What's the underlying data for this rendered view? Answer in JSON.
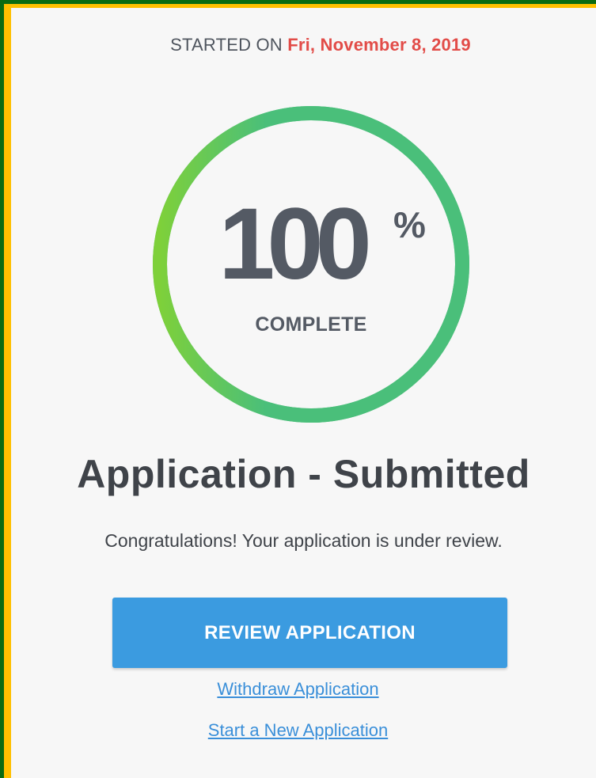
{
  "header": {
    "started_label": "STARTED ON",
    "started_date": "Fri, November 8, 2019"
  },
  "progress": {
    "value": 100,
    "number_text": "100",
    "percent_sign": "%",
    "label": "COMPLETE"
  },
  "status": {
    "title": "Application - Submitted",
    "message": "Congratulations! Your application is under review."
  },
  "actions": {
    "review_button": "REVIEW APPLICATION",
    "withdraw_link": "Withdraw Application",
    "new_application_link": "Start a New Application"
  },
  "colors": {
    "frame_border": "#0b6b12",
    "frame_fill": "#ffc000",
    "card_background": "#f7f7f7",
    "date_accent": "#e24c48",
    "ring_start": "#7ed03a",
    "ring_end": "#4abf7a",
    "button": "#3b9be0",
    "link": "#3a8fd9"
  }
}
